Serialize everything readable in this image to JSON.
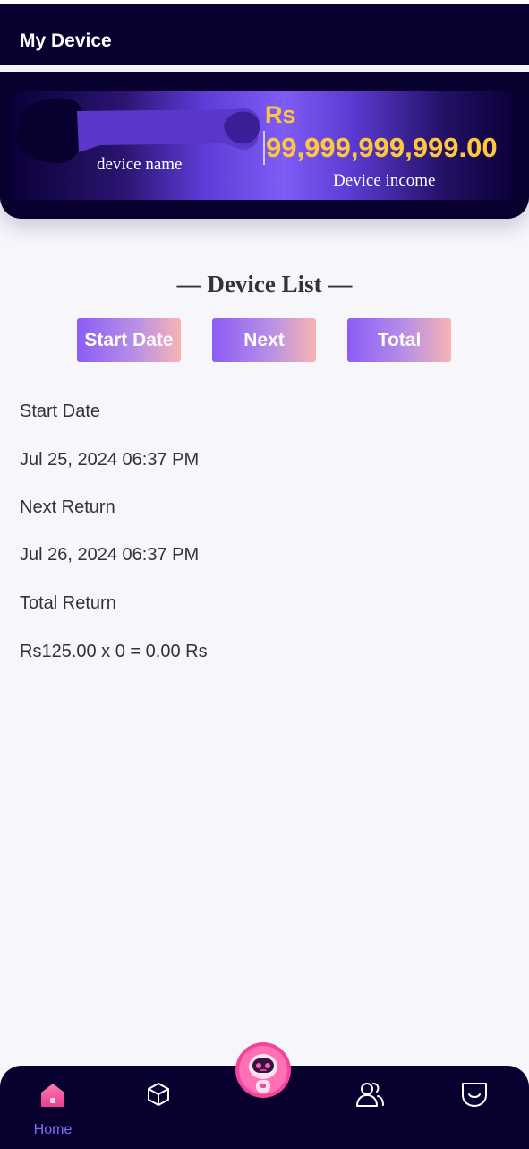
{
  "header": {
    "title": "My Device"
  },
  "hero": {
    "device_name_label": "device name",
    "currency": "Rs",
    "amount": "99,999,999,999.00",
    "income_label": "Device income"
  },
  "device_list": {
    "title": "— Device List —",
    "tabs": [
      {
        "label": "Start Date"
      },
      {
        "label": "Next"
      },
      {
        "label": "Total"
      }
    ],
    "rows": [
      {
        "text": "Start Date"
      },
      {
        "text": "Jul 25, 2024 06:37 PM"
      },
      {
        "text": "Next Return"
      },
      {
        "text": "Jul 26, 2024 06:37 PM"
      },
      {
        "text": "Total Return"
      },
      {
        "text": "Rs125.00 x 0 = 0.00 Rs"
      }
    ]
  },
  "bottom_nav": {
    "items": [
      {
        "label": "Home",
        "icon": "home-icon",
        "active": true
      },
      {
        "label": "",
        "icon": "box-icon"
      },
      {
        "label": "",
        "icon": "robot-assistant-icon"
      },
      {
        "label": "",
        "icon": "users-icon"
      },
      {
        "label": "",
        "icon": "smile-icon"
      }
    ]
  },
  "colors": {
    "header_bg": "#08002e",
    "accent_gold": "#ffc83c",
    "accent_purple": "#8b5cf6",
    "button_end": "#f7b4b4",
    "page_bg": "#f7f6fb"
  }
}
